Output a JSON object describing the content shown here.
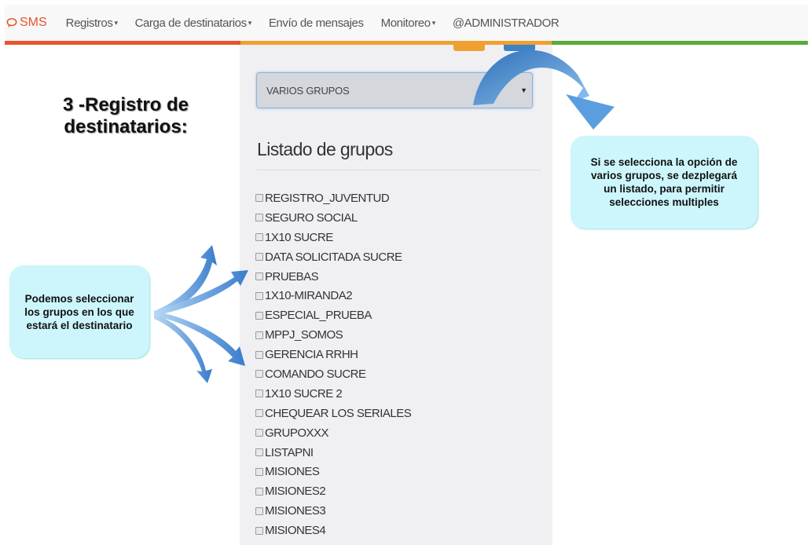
{
  "navbar": {
    "brand": "SMS",
    "items": [
      {
        "label": "Registros",
        "caret": "▾"
      },
      {
        "label": "Carga de destinatarios",
        "caret": "▾"
      },
      {
        "label": "Envío de mensajes",
        "caret": ""
      },
      {
        "label": "Monitoreo",
        "caret": "▾"
      },
      {
        "label": "@ADMINISTRADOR",
        "caret": ""
      }
    ]
  },
  "colors": {
    "accent_red": "#e8542f",
    "accent_orange": "#f0a030",
    "accent_green": "#5aab3a",
    "accent_blue": "#3a83c6",
    "bubble": "#ccf6fb",
    "arrow": "#5b9ee0"
  },
  "form": {
    "select_value": "VARIOS GRUPOS",
    "select_arrow": "▼",
    "list_title": "Listado de grupos",
    "groups": [
      "REGISTRO_JUVENTUD",
      "SEGURO SOCIAL",
      "1X10 SUCRE",
      "DATA SOLICITADA SUCRE",
      "PRUEBAS",
      "1X10-MIRANDA2",
      "ESPECIAL_PRUEBA",
      "MPPJ_SOMOS",
      "GERENCIA RRHH",
      "COMANDO SUCRE",
      "1X10 SUCRE 2",
      "CHEQUEAR LOS SERIALES",
      "GRUPOXXX",
      "LISTAPNI",
      "MISIONES",
      "MISIONES2",
      "MISIONES3",
      "MISIONES4"
    ]
  },
  "annotations": {
    "title_line1": "3 -Registro de",
    "title_line2": "destinatarios:",
    "right_bubble": "Si se selecciona la opción de varios grupos, se dezplegará un listado, para permitir selecciones multiples",
    "left_bubble": "Podemos seleccionar los grupos en los que estará el destinatario"
  }
}
